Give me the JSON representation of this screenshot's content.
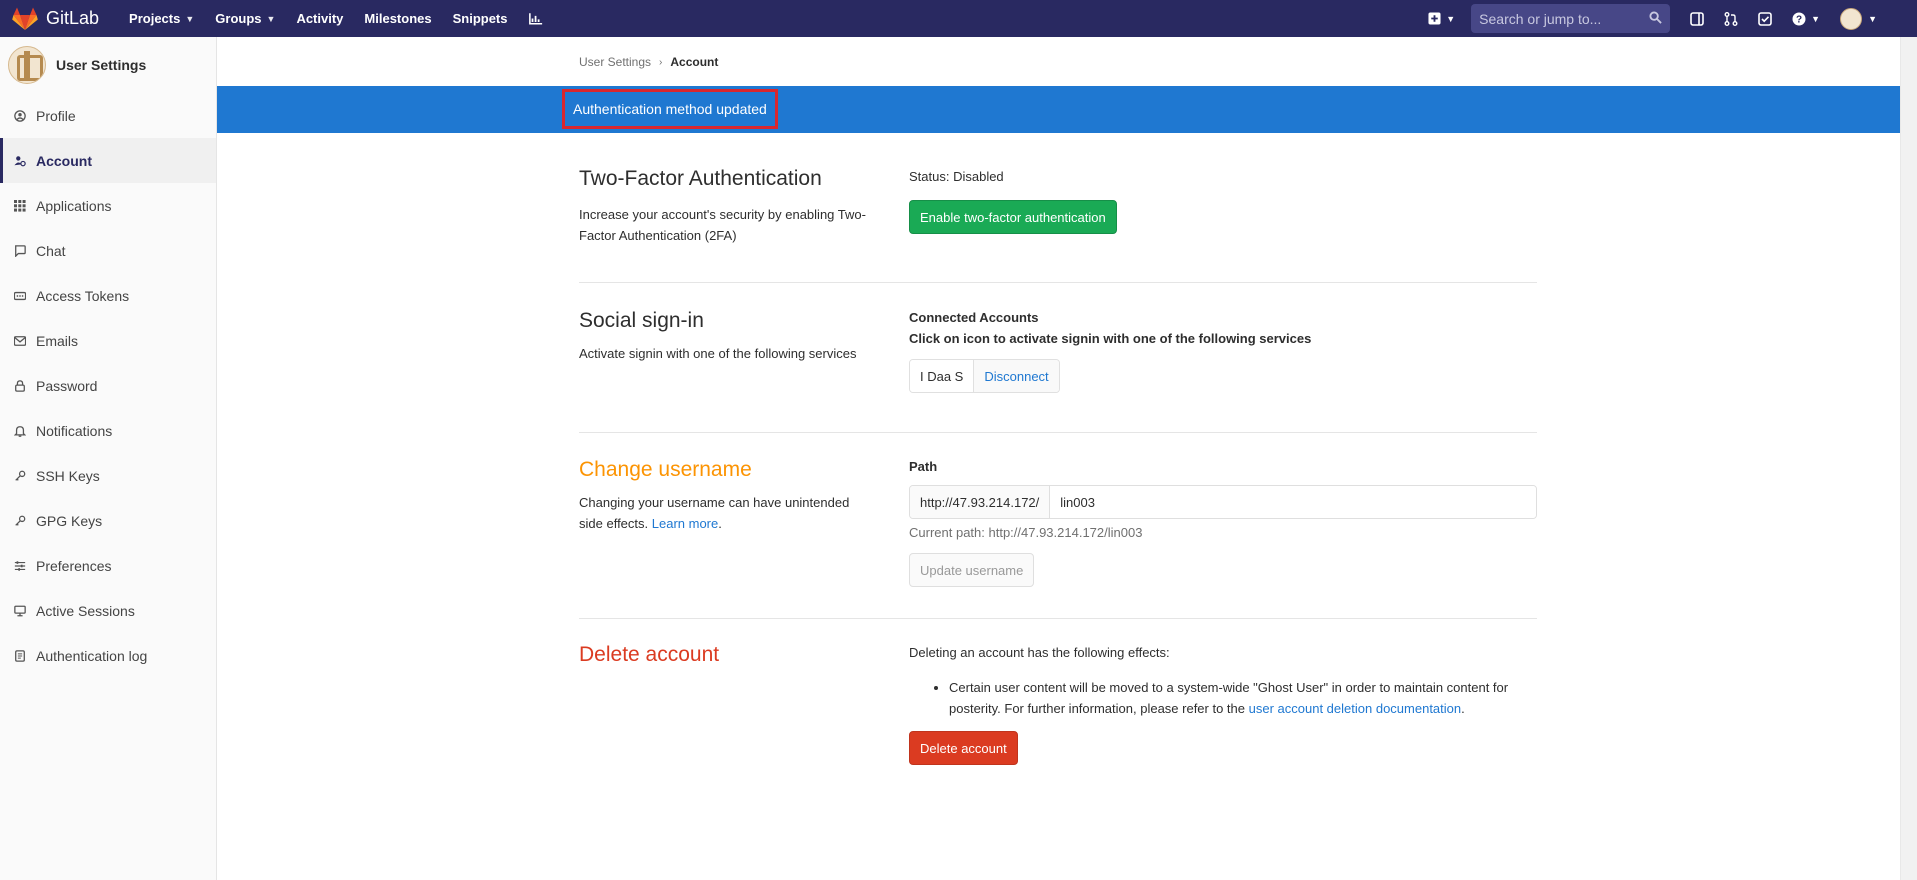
{
  "navbar": {
    "brand": "GitLab",
    "links": [
      {
        "label": "Projects",
        "caret": true
      },
      {
        "label": "Groups",
        "caret": true
      },
      {
        "label": "Activity",
        "caret": false
      },
      {
        "label": "Milestones",
        "caret": false
      },
      {
        "label": "Snippets",
        "caret": false
      }
    ],
    "search_placeholder": "Search or jump to...",
    "icons": [
      "plus-square-icon",
      "sidebar-panel-icon",
      "merge-request-icon",
      "todo-check-icon",
      "help-icon",
      "user-avatar"
    ]
  },
  "sidebar": {
    "title": "User Settings",
    "items": [
      {
        "label": "Profile",
        "icon": "profile-icon",
        "active": false
      },
      {
        "label": "Account",
        "icon": "account-icon",
        "active": true
      },
      {
        "label": "Applications",
        "icon": "applications-icon",
        "active": false
      },
      {
        "label": "Chat",
        "icon": "chat-icon",
        "active": false
      },
      {
        "label": "Access Tokens",
        "icon": "access-tokens-icon",
        "active": false
      },
      {
        "label": "Emails",
        "icon": "emails-icon",
        "active": false
      },
      {
        "label": "Password",
        "icon": "password-lock-icon",
        "active": false
      },
      {
        "label": "Notifications",
        "icon": "notifications-bell-icon",
        "active": false
      },
      {
        "label": "SSH Keys",
        "icon": "ssh-key-icon",
        "active": false
      },
      {
        "label": "GPG Keys",
        "icon": "gpg-key-icon",
        "active": false
      },
      {
        "label": "Preferences",
        "icon": "preferences-icon",
        "active": false
      },
      {
        "label": "Active Sessions",
        "icon": "active-sessions-icon",
        "active": false
      },
      {
        "label": "Authentication log",
        "icon": "authentication-log-icon",
        "active": false
      }
    ]
  },
  "breadcrumb": {
    "parent": "User Settings",
    "current": "Account"
  },
  "flash": {
    "message": "Authentication method updated"
  },
  "two_factor": {
    "title": "Two-Factor Authentication",
    "description": "Increase your account's security by enabling Two-Factor Authentication (2FA)",
    "status": "Status: Disabled",
    "button": "Enable two-factor authentication"
  },
  "social": {
    "title": "Social sign-in",
    "description": "Activate signin with one of the following services",
    "connected_label": "Connected Accounts",
    "instructions": "Click on icon to activate signin with one of the following services",
    "provider": "I Daa S",
    "disconnect": "Disconnect"
  },
  "username": {
    "title": "Change username",
    "description": "Changing your username can have unintended side effects.",
    "learn_more": "Learn more",
    "path_label": "Path",
    "prefix": "http://47.93.214.172/",
    "value": "lin003",
    "current_path": "Current path: http://47.93.214.172/lin003",
    "button": "Update username"
  },
  "delete": {
    "title": "Delete account",
    "intro": "Deleting an account has the following effects:",
    "effect_text": "Certain user content will be moved to a system-wide \"Ghost User\" in order to maintain content for posterity. For further information, please refer to the",
    "effect_link": "user account deletion documentation",
    "button": "Delete account"
  },
  "colors": {
    "navbar": "#292961",
    "flash": "#1f78d1",
    "success": "#1aaa55",
    "danger": "#db3b21",
    "warning_title": "#fc9403",
    "link": "#1f78d1"
  }
}
